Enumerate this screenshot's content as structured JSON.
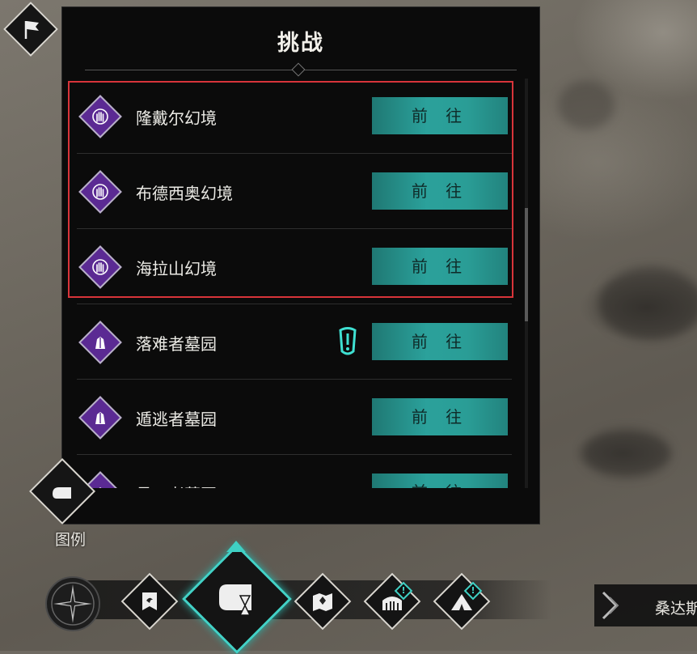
{
  "panel": {
    "title": "挑战",
    "rows": [
      {
        "name": "隆戴尔幻境",
        "button": "前 往",
        "icon": "palm-mandala-icon"
      },
      {
        "name": "布德西奥幻境",
        "button": "前 往",
        "icon": "palm-mandala-icon"
      },
      {
        "name": "海拉山幻境",
        "button": "前 往",
        "icon": "palm-mandala-icon"
      },
      {
        "name": "落难者墓园",
        "button": "前 往",
        "icon": "hands-pray-icon",
        "badge": "exclamation-scroll-icon"
      },
      {
        "name": "遁逃者墓园",
        "button": "前 往",
        "icon": "hands-pray-icon"
      },
      {
        "name": "邑口者墓园",
        "button": "前 往",
        "icon": "hands-pray-icon"
      }
    ]
  },
  "legend": {
    "label": "图例"
  },
  "region": {
    "label": "桑达斯"
  },
  "toolbar": {
    "items": [
      "compass-icon",
      "banner-icon",
      "scroll-hourglass-icon",
      "map-icon",
      "arena-alert-icon",
      "camp-alert-icon"
    ]
  },
  "colors": {
    "accent": "#2ba19b",
    "highlight": "#d8343a",
    "icon_purple": "#5b2a93"
  }
}
